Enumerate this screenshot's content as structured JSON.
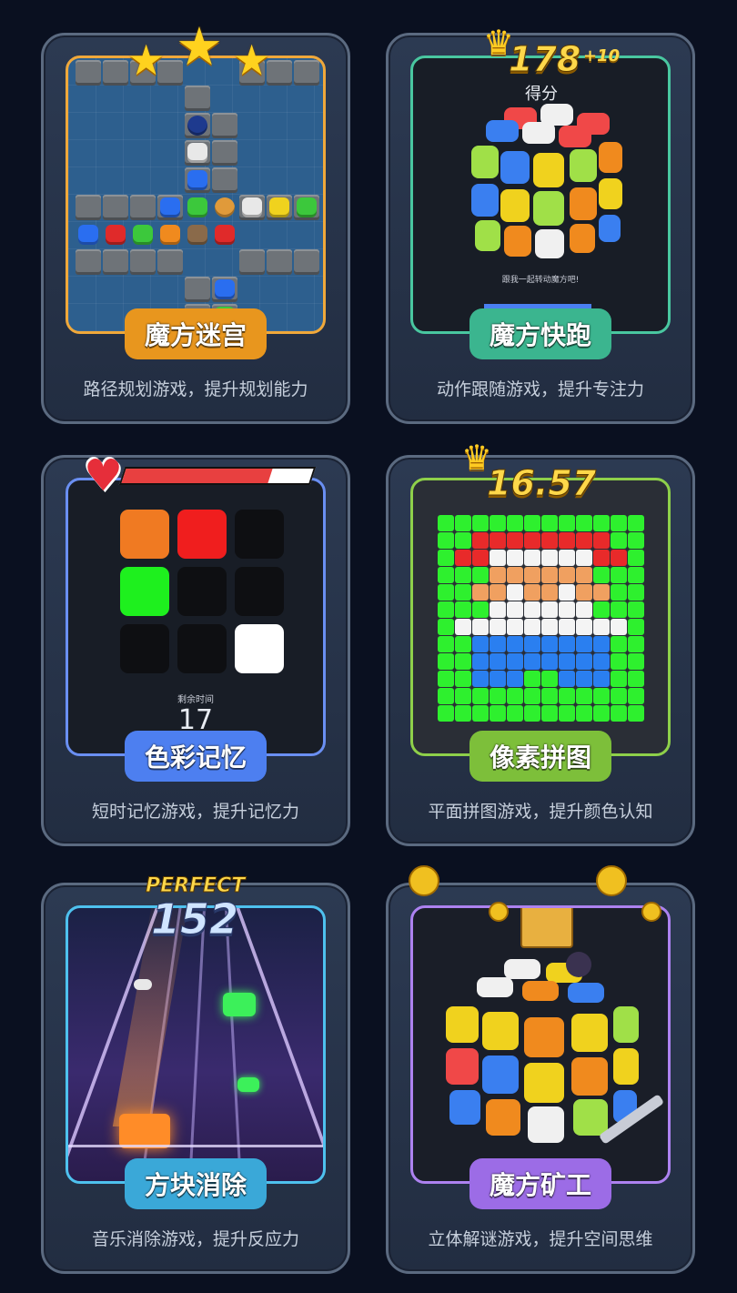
{
  "cards": [
    {
      "title": "魔方迷宫",
      "desc": "路径规划游戏，提升规划能力",
      "badge_color": "#e8961e",
      "frame_color": "#f0a83a"
    },
    {
      "title": "魔方快跑",
      "desc": "动作跟随游戏，提升专注力",
      "badge_color": "#3bb58f",
      "frame_color": "#49c7a0",
      "score": "178",
      "bonus": "+10",
      "score_label": "得分",
      "prompt": "跟我一起转动魔方吧!"
    },
    {
      "title": "色彩记忆",
      "desc": "短时记忆游戏，提升记忆力",
      "badge_color": "#4d7ff0",
      "frame_color": "#6a8ff2",
      "timer_label": "剩余时间",
      "timer_value": "17"
    },
    {
      "title": "像素拼图",
      "desc": "平面拼图游戏，提升颜色认知",
      "badge_color": "#7dbf3a",
      "frame_color": "#8ed04a",
      "time": "16.57"
    },
    {
      "title": "方块消除",
      "desc": "音乐消除游戏，提升反应力",
      "badge_color": "#3aa8d8",
      "frame_color": "#4ec1ee",
      "rating": "PERFECT",
      "combo": "152"
    },
    {
      "title": "魔方矿工",
      "desc": "立体解谜游戏，提升空间思维",
      "badge_color": "#9c6ce6",
      "frame_color": "#ad82f0"
    }
  ]
}
